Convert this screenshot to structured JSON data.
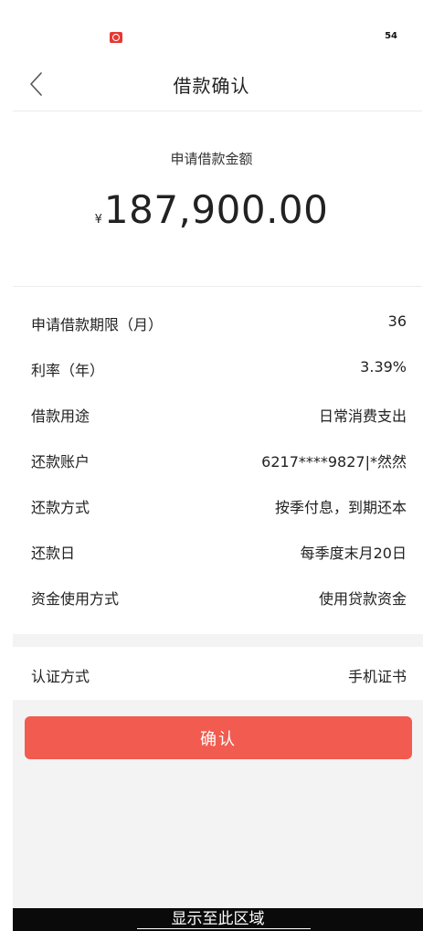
{
  "status_bar": {
    "app_icon": "app-logo-icon",
    "battery": "54"
  },
  "header": {
    "back_icon": "chevron-left-icon",
    "title": "借款确认"
  },
  "amount": {
    "label": "申请借款金额",
    "currency_symbol": "¥",
    "value": "187,900.00"
  },
  "details": [
    {
      "label": "申请借款期限（月）",
      "value": "36"
    },
    {
      "label": "利率（年）",
      "value": "3.39%"
    },
    {
      "label": "借款用途",
      "value": "日常消费支出"
    },
    {
      "label": "还款账户",
      "value": "6217****9827|*然然"
    },
    {
      "label": "还款方式",
      "value": "按季付息，到期还本"
    },
    {
      "label": "还款日",
      "value": "每季度末月20日"
    },
    {
      "label": "资金使用方式",
      "value": "使用贷款资金"
    }
  ],
  "auth": {
    "label": "认证方式",
    "value": "手机证书"
  },
  "confirm_button": {
    "label": "确认"
  },
  "bottom_bar": {
    "text": "显示至此区域"
  },
  "colors": {
    "accent": "#f25b4f",
    "app_icon": "#e53935",
    "section_bg": "#f3f3f3"
  }
}
